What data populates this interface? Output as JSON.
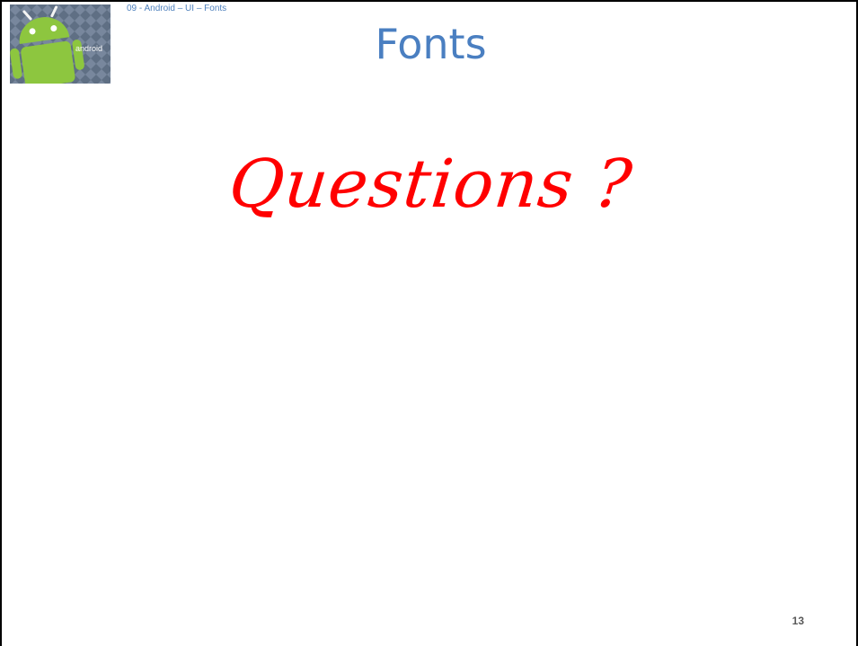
{
  "header": {
    "breadcrumb": "09 -  Android – UI – Fonts",
    "logo_icon": "android-logo-icon",
    "logo_text": "android"
  },
  "slide": {
    "title": "Fonts",
    "body_text": "Questions ?",
    "page_number": "13"
  },
  "colors": {
    "title": "#4a7fc1",
    "breadcrumb": "#4f81bd",
    "body_text": "#ff0000",
    "android_green": "#8dc63f"
  }
}
